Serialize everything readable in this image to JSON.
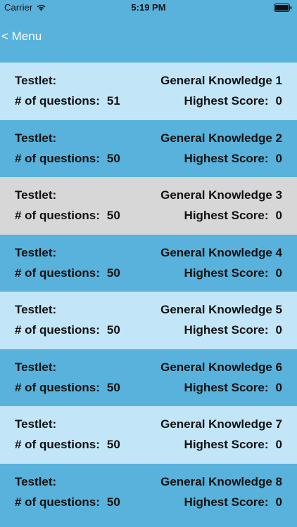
{
  "status_bar": {
    "carrier": "Carrier",
    "time": "5:19 PM",
    "wifi_icon": "wifi-icon",
    "battery_icon": "battery-icon"
  },
  "nav": {
    "back_label": "< Menu"
  },
  "labels": {
    "testlet": "Testlet:",
    "num_questions": "# of questions:",
    "highest_score": "Highest Score:"
  },
  "colors": {
    "background_blue": "#58b2db",
    "light_row": "#c2e6f8",
    "grey_row": "#d7d7d7"
  },
  "testlets": [
    {
      "name": "General Knowledge 1",
      "questions": "51",
      "highest_score": "0",
      "style": "light"
    },
    {
      "name": "General Knowledge 2",
      "questions": "50",
      "highest_score": "0",
      "style": "mid"
    },
    {
      "name": "General Knowledge 3",
      "questions": "50",
      "highest_score": "0",
      "style": "grey"
    },
    {
      "name": "General Knowledge 4",
      "questions": "50",
      "highest_score": "0",
      "style": "mid"
    },
    {
      "name": "General Knowledge 5",
      "questions": "50",
      "highest_score": "0",
      "style": "light"
    },
    {
      "name": "General Knowledge 6",
      "questions": "50",
      "highest_score": "0",
      "style": "mid"
    },
    {
      "name": "General Knowledge 7",
      "questions": "50",
      "highest_score": "0",
      "style": "light"
    },
    {
      "name": "General Knowledge 8",
      "questions": "50",
      "highest_score": "0",
      "style": "mid"
    }
  ]
}
